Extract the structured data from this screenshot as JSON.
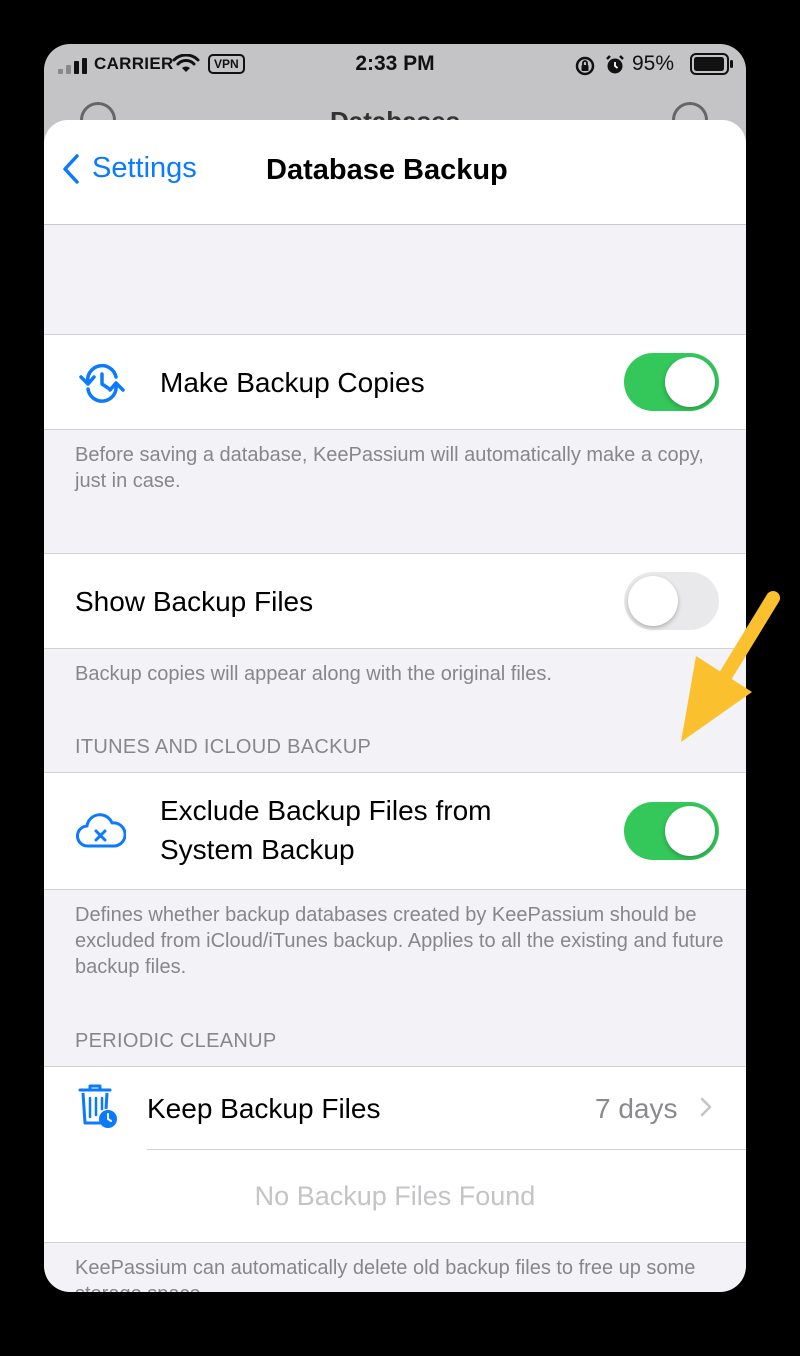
{
  "status_bar": {
    "carrier": "CARRIER",
    "vpn": "VPN",
    "time": "2:33 PM",
    "battery": "95%"
  },
  "background": {
    "nav_title": "Databases"
  },
  "navbar": {
    "back_label": "Settings",
    "title": "Database Backup"
  },
  "sections": {
    "make_backup": {
      "label": "Make Backup Copies",
      "enabled": true,
      "footer": "Before saving a database, KeePassium will automatically make a copy, just in case."
    },
    "show_backup": {
      "label": "Show Backup Files",
      "enabled": false,
      "footer": "Backup copies will appear along with the original files."
    },
    "itunes": {
      "header": "ITUNES AND ICLOUD BACKUP",
      "label_line1": "Exclude Backup Files from",
      "label_line2": "System Backup",
      "enabled": true,
      "footer": "Defines whether backup databases created by KeePassium should be excluded from iCloud/iTunes backup. Applies to all the existing and future backup files."
    },
    "cleanup": {
      "header": "PERIODIC CLEANUP",
      "keep_label": "Keep Backup Files",
      "keep_value": "7 days",
      "empty_text": "No Backup Files Found",
      "footer": "KeePassium can automatically delete old backup files to free up some storage space."
    }
  },
  "colors": {
    "accent": "#0a7aff",
    "toggle_on": "#34c759",
    "arrow": "#fbc02d"
  }
}
